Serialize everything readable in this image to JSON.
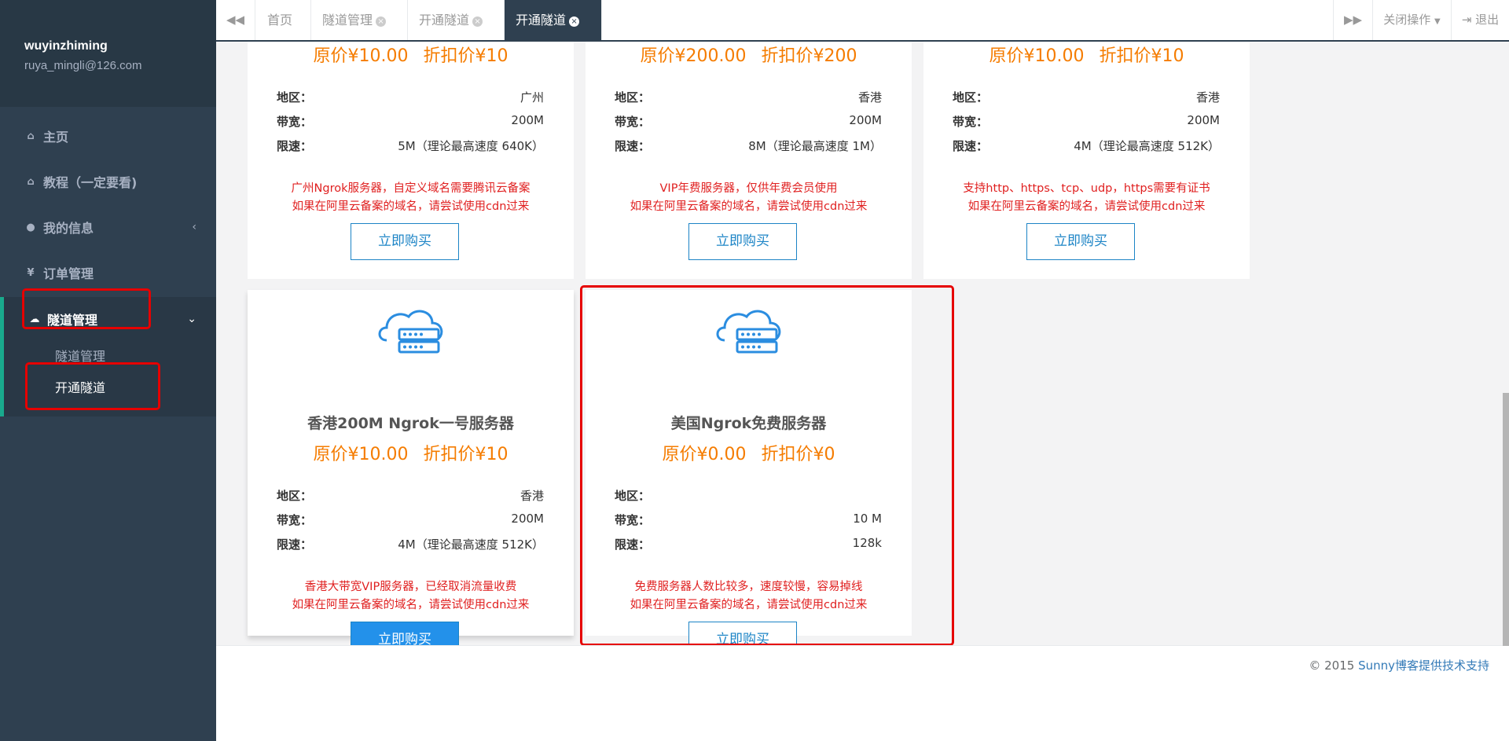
{
  "profile": {
    "username": "wuyinzhiming",
    "email": "ruya_mingli@126.com"
  },
  "nav": [
    {
      "label": "主页",
      "icon": "home-icon"
    },
    {
      "label": "教程（一定要看)",
      "icon": "home-icon"
    },
    {
      "label": "我的信息",
      "icon": "user-icon",
      "arrow": "‹"
    },
    {
      "label": "订单管理",
      "icon": "yen-icon"
    }
  ],
  "tunnel_nav": {
    "label": "隧道管理",
    "arrow": "⌄",
    "sub": [
      "隧道管理",
      "开通隧道"
    ]
  },
  "tabs": {
    "home": "首页",
    "items": [
      "隧道管理",
      "开通隧道",
      "开通隧道"
    ],
    "close_ops": "关闭操作",
    "logout": "退出"
  },
  "labels": {
    "region": "地区：",
    "bandwidth": "带宽：",
    "limit": "限速：",
    "buy": "立即购买"
  },
  "cards": [
    {
      "name": "",
      "price": "原价¥10.00 折扣价¥10",
      "region": "广州",
      "bandwidth": "200M",
      "limit": "5M（理论最高速度 640K）",
      "desc1": "广州Ngrok服务器，自定义域名需要腾讯云备案",
      "desc2": "如果在阿里云备案的域名，请尝试使用cdn过来"
    },
    {
      "name": "",
      "price": "原价¥200.00 折扣价¥200",
      "region": "香港",
      "bandwidth": "200M",
      "limit": "8M（理论最高速度 1M）",
      "desc1": "VIP年费服务器，仅供年费会员使用",
      "desc2": "如果在阿里云备案的域名，请尝试使用cdn过来"
    },
    {
      "name": "",
      "price": "原价¥10.00 折扣价¥10",
      "region": "香港",
      "bandwidth": "200M",
      "limit": "4M（理论最高速度 512K）",
      "desc1": "支持http、https、tcp、udp，https需要有证书",
      "desc2": "如果在阿里云备案的域名，请尝试使用cdn过来"
    },
    {
      "name": "香港200M Ngrok一号服务器",
      "price": "原价¥10.00 折扣价¥10",
      "region": "香港",
      "bandwidth": "200M",
      "limit": "4M（理论最高速度 512K）",
      "desc1": "香港大带宽VIP服务器，已经取消流量收费",
      "desc2": "如果在阿里云备案的域名，请尝试使用cdn过来"
    },
    {
      "name": "美国Ngrok免费服务器",
      "price": "原价¥0.00 折扣价¥0",
      "region": "",
      "bandwidth": "10 M",
      "limit": "128k",
      "desc1": "免费服务器人数比较多，速度较慢，容易掉线",
      "desc2": "如果在阿里云备案的域名，请尝试使用cdn过来"
    }
  ],
  "footer": {
    "copyright": "© 2015 ",
    "link": "Sunny博客提供技术支持"
  },
  "colors": {
    "sidebar": "#2f4050",
    "accent": "#19aa8d",
    "price": "#f57c00",
    "desc": "#e02020",
    "button": "#1c84c6",
    "highlight": "#e60000"
  }
}
